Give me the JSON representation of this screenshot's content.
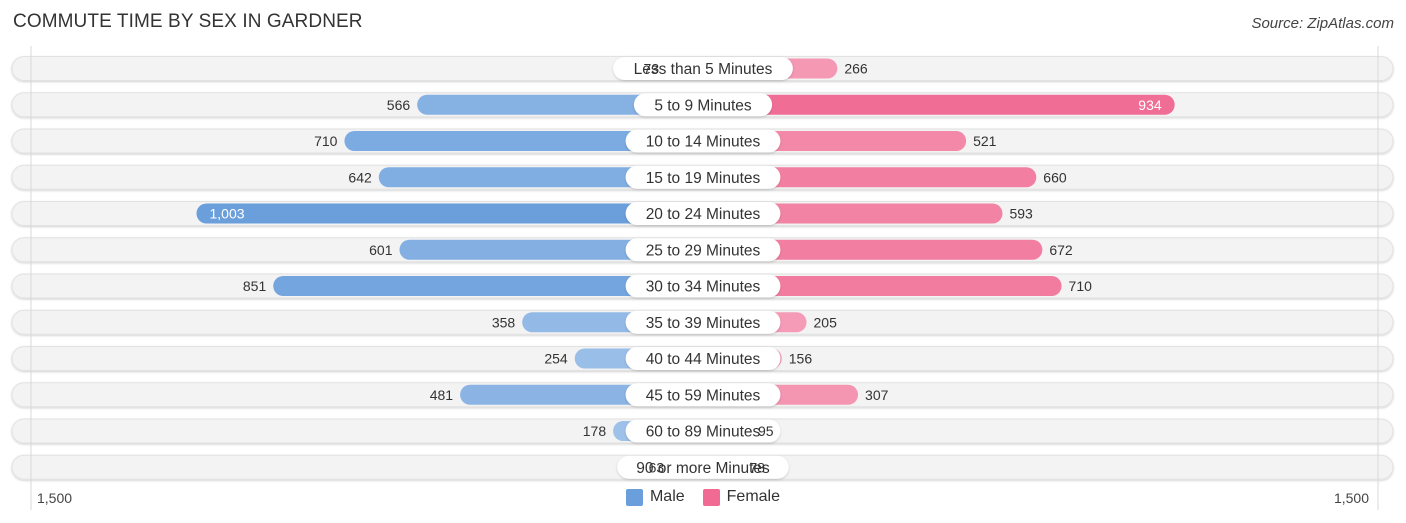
{
  "header": {
    "title": "COMMUTE TIME BY SEX IN GARDNER",
    "source": "Source: ZipAtlas.com"
  },
  "colors": {
    "male": "#6a9fdc",
    "male_light": "#a9c8ec",
    "female": "#f06a93",
    "female_light": "#f6a8c0",
    "track": "#f3f3f3"
  },
  "chart_data": {
    "type": "bar",
    "orientation": "horizontal-diverging",
    "title": "COMMUTE TIME BY SEX IN GARDNER",
    "categories": [
      "Less than 5 Minutes",
      "5 to 9 Minutes",
      "10 to 14 Minutes",
      "15 to 19 Minutes",
      "20 to 24 Minutes",
      "25 to 29 Minutes",
      "30 to 34 Minutes",
      "35 to 39 Minutes",
      "40 to 44 Minutes",
      "45 to 59 Minutes",
      "60 to 89 Minutes",
      "90 or more Minutes"
    ],
    "series": [
      {
        "name": "Male",
        "values": [
          73,
          566,
          710,
          642,
          1003,
          601,
          851,
          358,
          254,
          481,
          178,
          63
        ],
        "labels": [
          "73",
          "566",
          "710",
          "642",
          "1,003",
          "601",
          "851",
          "358",
          "254",
          "481",
          "178",
          "63"
        ]
      },
      {
        "name": "Female",
        "values": [
          266,
          934,
          521,
          660,
          593,
          672,
          710,
          205,
          156,
          307,
          95,
          78
        ],
        "labels": [
          "266",
          "934",
          "521",
          "660",
          "593",
          "672",
          "710",
          "205",
          "156",
          "307",
          "95",
          "78"
        ]
      }
    ],
    "axis": {
      "min_label": "1,500",
      "max_label": "1,500",
      "range": [
        -1500,
        1500
      ]
    },
    "legend": {
      "position": "bottom-center",
      "items": [
        "Male",
        "Female"
      ]
    },
    "grid": false
  }
}
